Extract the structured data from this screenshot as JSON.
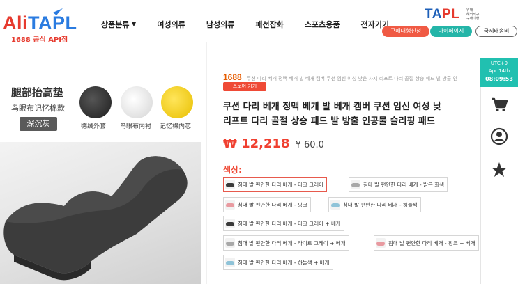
{
  "header": {
    "logo": {
      "brand": "AliTAPL",
      "brand_left": "Ali",
      "brand_right": "TAPL",
      "sub": "1688 공식 API점"
    },
    "nav": [
      {
        "label": "상품분류",
        "has_caret": true
      },
      {
        "label": "여성의류"
      },
      {
        "label": "남성의류"
      },
      {
        "label": "패션잡화"
      },
      {
        "label": "스포츠용품"
      },
      {
        "label": "전자기기"
      }
    ],
    "tapl_logo": {
      "text_a": "TA",
      "text_b": "PL",
      "side": [
        "위해",
        "해외직구",
        "구매대행"
      ]
    },
    "buttons": {
      "agency": "구매대행신청",
      "mypage": "마이페이지",
      "intl_shipping": "국제배송비"
    }
  },
  "side_panel": {
    "timezone": "UTC+9",
    "date": "Apr 14th",
    "time": "08:09:53",
    "icons": [
      "cart-icon",
      "user-icon",
      "star-icon"
    ]
  },
  "product_image": {
    "title": "腿部抬高垫",
    "subtitle": "鸟眼布记忆棉款",
    "tag": "深沉灰",
    "swatches": [
      {
        "caption": "德绒外套",
        "color": "#2b2b2b"
      },
      {
        "caption": "鸟眼布内衬",
        "color": "#e8e8e8"
      },
      {
        "caption": "记忆棉内芯",
        "color": "#f4d21a"
      }
    ]
  },
  "product": {
    "source_badge": "1688",
    "source_text": "쿠션 다리 베개 정맥 베개 발 베개 캠버 쿠션 임신 여성 낮은 사지 리프트 다리 골절 상승 패드 발 방출 인",
    "store_button": "스토어 가기",
    "title_line1": "쿠션 다리 베개 정맥 베개 발 베개 캠버 쿠션 임신 여성 낮",
    "title_line2": "리프트 다리 골절 상승 패드 발 방출 인공물 슬리핑 패드",
    "price_krw": "₩ 12,218",
    "price_cny": "¥ 60.0",
    "color_label": "색상:",
    "options": [
      {
        "label": "침대 발 편안한 다리 베개 - 다크 그레이",
        "thumb": "#3a3a3a",
        "selected": true
      },
      {
        "label": "침대 발 편안한 다리 베개 - 밝은 회색",
        "thumb": "#a8a8a8",
        "selected": false
      },
      {
        "label": "침대 발 편안한 다리 베개 - 핑크",
        "thumb": "#e89aa0",
        "selected": false
      },
      {
        "label": "침대 발 편안한 다리 베개 - 하늘색",
        "thumb": "#8fc3d8",
        "selected": false
      },
      {
        "label": "침대 발 편안한 다리 베개 - 다크 그레이 + 베개",
        "thumb": "#3a3a3a",
        "selected": false
      },
      {
        "label": "침대 발 편안한 다리 베개 - 라이트 그레이 + 베개",
        "thumb": "#a8a8a8",
        "selected": false
      },
      {
        "label": "침대 발 편안한 다리 베개 - 핑크 + 베개",
        "thumb": "#e89aa0",
        "selected": false
      },
      {
        "label": "침대 발 편안한 다리 베개 - 하늘색 + 베개",
        "thumb": "#8fc3d8",
        "selected": false
      }
    ]
  },
  "colors": {
    "brand_red": "#e63a2e",
    "brand_blue": "#2a7be0",
    "teal": "#21c0b0",
    "price_red": "#f04030"
  }
}
